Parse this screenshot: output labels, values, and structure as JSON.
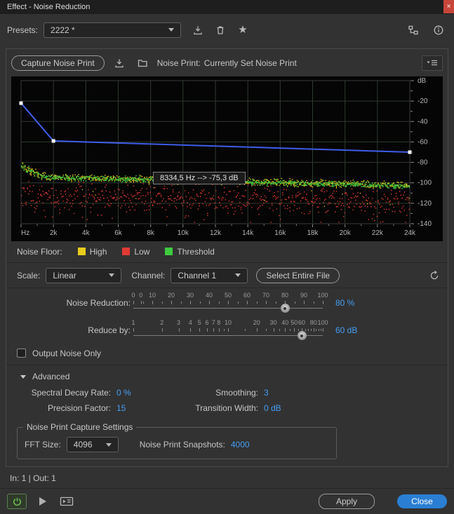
{
  "window": {
    "title": "Effect - Noise Reduction",
    "close_glyph": "×"
  },
  "presets": {
    "label": "Presets:",
    "value": "2222 *"
  },
  "noise_print": {
    "capture_button": "Capture Noise Print",
    "status_label": "Noise Print:",
    "status_value": "Currently Set Noise Print"
  },
  "graph": {
    "x_ticks": [
      "Hz",
      "2k",
      "4k",
      "6k",
      "8k",
      "10k",
      "12k",
      "14k",
      "16k",
      "18k",
      "20k",
      "22k",
      "24k"
    ],
    "y_ticks": [
      "dB",
      "-20",
      "-40",
      "-60",
      "-80",
      "-100",
      "-120",
      "-140"
    ],
    "tooltip": "8334,5 Hz --> -75,3 dB",
    "envelope_points": [
      [
        0,
        -22
      ],
      [
        2000,
        -59
      ],
      [
        24000,
        -70
      ]
    ],
    "colors": {
      "bg": "#050505",
      "grid": "#2e3a2e",
      "envelope": "#3f5de8",
      "high": "#e8cc1e",
      "low": "#e03a34",
      "threshold": "#3ecb3e"
    }
  },
  "legend": {
    "label": "Noise Floor:",
    "high": "High",
    "low": "Low",
    "threshold": "Threshold"
  },
  "controls": {
    "scale_label": "Scale:",
    "scale_value": "Linear",
    "channel_label": "Channel:",
    "channel_value": "Channel 1",
    "select_button": "Select Entire File"
  },
  "sliders": {
    "noise_reduction": {
      "label": "Noise Reduction:",
      "value": "80 %",
      "handle_pos": 0.8,
      "ticks": [
        {
          "label": "0",
          "pos": 0
        },
        {
          "label": "0",
          "pos": 0.04
        },
        {
          "label": "10",
          "pos": 0.1
        },
        {
          "label": "20",
          "pos": 0.2
        },
        {
          "label": "30",
          "pos": 0.3
        },
        {
          "label": "40",
          "pos": 0.4
        },
        {
          "label": "50",
          "pos": 0.5
        },
        {
          "label": "60",
          "pos": 0.6
        },
        {
          "label": "70",
          "pos": 0.7
        },
        {
          "label": "80",
          "pos": 0.8
        },
        {
          "label": "90",
          "pos": 0.9
        },
        {
          "label": "100",
          "pos": 1
        }
      ],
      "minor_ticks": [
        0.05,
        0.15,
        0.25,
        0.35,
        0.45,
        0.55,
        0.65,
        0.75,
        0.85,
        0.95
      ]
    },
    "reduce_by": {
      "label": "Reduce by:",
      "value": "60 dB",
      "handle_pos": 0.889,
      "ticks": [
        {
          "label": "1",
          "pos": 0
        },
        {
          "label": "2",
          "pos": 0.151
        },
        {
          "label": "3",
          "pos": 0.239
        },
        {
          "label": "4",
          "pos": 0.301
        },
        {
          "label": "5",
          "pos": 0.349
        },
        {
          "label": "6",
          "pos": 0.389
        },
        {
          "label": "7",
          "pos": 0.423
        },
        {
          "label": "8",
          "pos": 0.451
        },
        {
          "label": "10",
          "pos": 0.5
        },
        {
          "label": "20",
          "pos": 0.651
        },
        {
          "label": "30",
          "pos": 0.739
        },
        {
          "label": "40",
          "pos": 0.801
        },
        {
          "label": "50",
          "pos": 0.849
        },
        {
          "label": "60",
          "pos": 0.889
        },
        {
          "label": "80",
          "pos": 0.951
        },
        {
          "label": "100",
          "pos": 1
        }
      ],
      "minor_ticks": [
        0.477,
        0.588,
        0.699,
        0.772,
        0.826,
        0.87,
        0.906,
        0.922,
        0.938,
        0.964,
        0.977,
        0.989
      ]
    }
  },
  "output_noise_only": {
    "label": "Output Noise Only",
    "checked": false
  },
  "advanced": {
    "title": "Advanced",
    "spectral_decay_label": "Spectral Decay Rate:",
    "spectral_decay_value": "0 %",
    "smoothing_label": "Smoothing:",
    "smoothing_value": "3",
    "precision_label": "Precision Factor:",
    "precision_value": "15",
    "transition_label": "Transition Width:",
    "transition_value": "0 dB"
  },
  "capture_settings": {
    "title": "Noise Print Capture Settings",
    "fft_label": "FFT Size:",
    "fft_value": "4096",
    "snapshots_label": "Noise Print Snapshots:",
    "snapshots_value": "4000"
  },
  "footer": {
    "io": "In: 1 | Out: 1",
    "apply": "Apply",
    "close": "Close"
  },
  "colors": {
    "accent_blue": "#459df2",
    "button_blue": "#2a7fd4",
    "close_red": "#c8453a",
    "panel_bg": "#323232"
  }
}
